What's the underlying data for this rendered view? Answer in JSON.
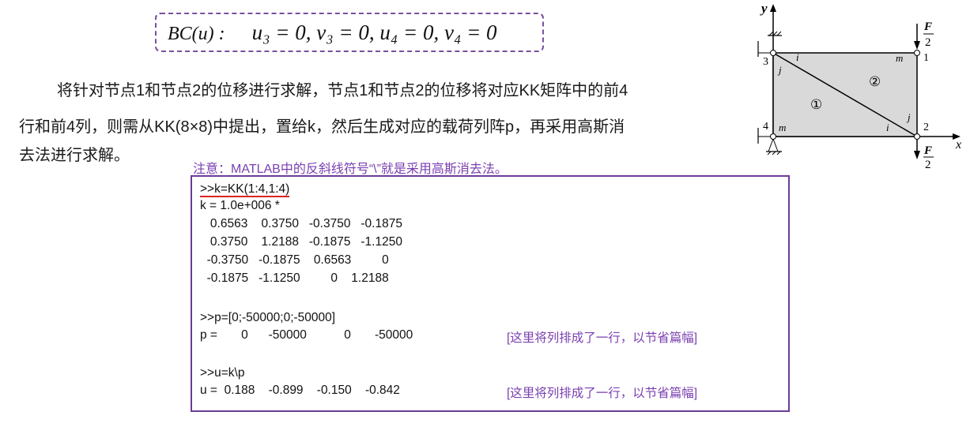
{
  "formula": {
    "label": "BC(u) :",
    "equation": "u₃ = 0, v₃ = 0, u₄ = 0, v₄ = 0"
  },
  "paragraph": {
    "line1": "将针对节点1和节点2的位移进行求解，节点1和节点2的位移将对应KK矩阵中的前4",
    "line2": "行和前4列，则需从KK(8×8)中提出，置给k，然后生成对应的载荷列阵p，再采用高斯消",
    "line3": "去法进行求解。"
  },
  "note": "注意：MATLAB中的反斜线符号“\\”就是采用高斯消去法。",
  "code": {
    "line1": ">>k=KK(1:4,1:4)",
    "line2": "k = 1.0e+006 *",
    "line3": "   0.6563    0.3750   -0.3750   -0.1875",
    "line4": "   0.3750    1.2188   -0.1875   -1.1250",
    "line5": "  -0.3750   -0.1875    0.6563         0",
    "line6": "  -0.1875   -1.1250         0    1.2188",
    "line7": ">>p=[0;-50000;0;-50000]",
    "line8": "p =       0      -50000           0       -50000",
    "line9": ">>u=k\\p",
    "line10": "u =  0.188    -0.899    -0.150    -0.842",
    "side_note_p": "[这里将列排成了一行，以节省篇幅]",
    "side_note_u": "[这里将列排成了一行，以节省篇幅]"
  },
  "diagram": {
    "axis_y": "y",
    "axis_x": "x",
    "load_top": "F",
    "load_top_den": "2",
    "load_bottom": "F",
    "load_bottom_den": "2",
    "node1": "1",
    "node2": "2",
    "node3": "3",
    "node4": "4",
    "elem1": "①",
    "elem2": "②",
    "i_top": "i",
    "j_left": "j",
    "m_top": "m",
    "m_bottom": "m",
    "i_bottom": "i",
    "j_right": "j",
    "fill_color": "#d9d9d9"
  }
}
